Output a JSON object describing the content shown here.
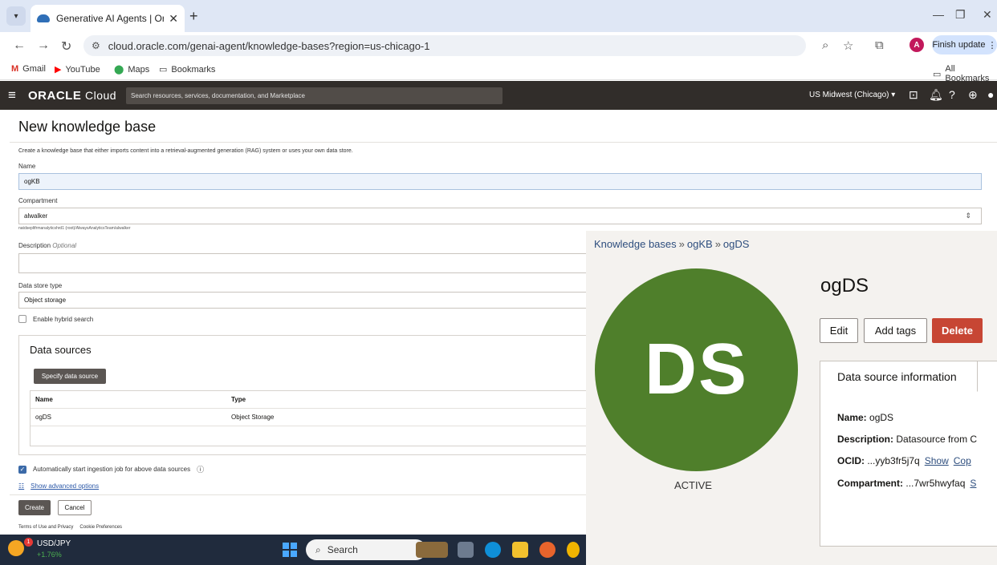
{
  "browser": {
    "tab_title": "Generative AI Agents | Oracle C",
    "url": "cloud.oracle.com/genai-agent/knowledge-bases?region=us-chicago-1",
    "finish_update": "Finish update",
    "profile_initial": "A",
    "bookmarks": [
      "Gmail",
      "YouTube",
      "Maps",
      "Bookmarks"
    ],
    "all_bookmarks": "All Bookmarks"
  },
  "oci": {
    "logo": "ORACLE",
    "logo_suffix": "Cloud",
    "search_placeholder": "Search resources, services, documentation, and Marketplace",
    "region": "US Midwest (Chicago)"
  },
  "form": {
    "title": "New knowledge base",
    "description": "Create a knowledge base that either imports content into a retrieval-augmented generation (RAG) system or uses your own data store.",
    "name_label": "Name",
    "name_value": "ogKB",
    "compartment_label": "Compartment",
    "compartment_value": "alwalker",
    "compartment_path": "natdsepltfrmanalyticshrd1 (root)/AlwaysAnalyticsTeam/alwalker",
    "desc_label": "Description",
    "desc_optional": "Optional",
    "store_label": "Data store type",
    "store_value": "Object storage",
    "hybrid_label": "Enable hybrid search",
    "data_sources_title": "Data sources",
    "specify_btn": "Specify data source",
    "table_headers": [
      "Name",
      "Type"
    ],
    "table_rows": [
      {
        "name": "ogDS",
        "type": "Object Storage"
      }
    ],
    "auto_ingest_label": "Automatically start ingestion job for above data sources",
    "advanced_link": "Show advanced options",
    "create_btn": "Create",
    "cancel_btn": "Cancel",
    "terms": "Terms of Use and Privacy",
    "cookies": "Cookie Preferences"
  },
  "taskbar": {
    "ticker": "USD/JPY",
    "change": "+1.76%",
    "badge": "1",
    "search": "Search"
  },
  "overlay": {
    "breadcrumb": [
      "Knowledge bases",
      "ogKB",
      "ogDS"
    ],
    "avatar_text": "DS",
    "status": "ACTIVE",
    "title": "ogDS",
    "edit_btn": "Edit",
    "tags_btn": "Add tags",
    "delete_btn": "Delete",
    "tab_label": "Data source information",
    "name_key": "Name:",
    "name_val": "ogDS",
    "desc_key": "Description:",
    "desc_val": "Datasource from C",
    "ocid_key": "OCID:",
    "ocid_val": "...yyb3fr5j7q",
    "show_link": "Show",
    "copy_link": "Cop",
    "comp_key": "Compartment:",
    "comp_val": "...7wr5hwyfaq",
    "comp_link": "S"
  },
  "colors": {
    "oci_header": "#312d2a",
    "avatar_green": "#4f7f2b",
    "delete_red": "#c74634",
    "link_blue": "#2e4e7e"
  }
}
